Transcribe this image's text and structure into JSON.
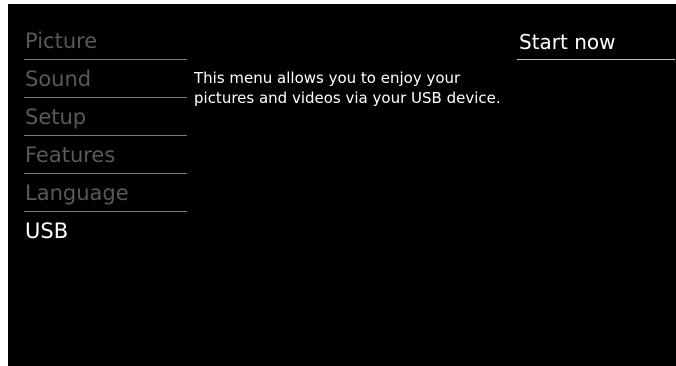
{
  "menu": {
    "items": [
      {
        "label": "Picture"
      },
      {
        "label": "Sound"
      },
      {
        "label": "Setup"
      },
      {
        "label": "Features"
      },
      {
        "label": "Language"
      },
      {
        "label": "USB"
      }
    ],
    "selected": "USB"
  },
  "description": {
    "text": "This menu allows you to enjoy your pictures and videos via your USB device."
  },
  "actions": {
    "start_now": "Start now"
  }
}
